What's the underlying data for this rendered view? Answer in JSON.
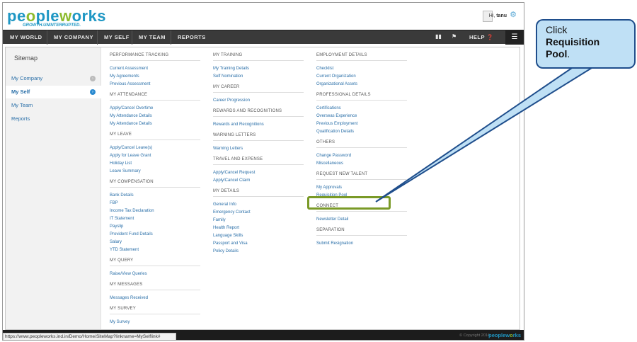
{
  "logo": {
    "main": "peopleworks",
    "tagline": "GROWTH.UNINTERRUPTED."
  },
  "user": {
    "greeting": "Hi, ",
    "name": "tanu"
  },
  "nav": {
    "items": [
      "MY WORLD",
      "MY COMPANY",
      "MY SELF",
      "MY TEAM",
      "REPORTS"
    ],
    "help": "HELP"
  },
  "sidebar": {
    "title": "Sitemap",
    "items": [
      {
        "label": "My Company",
        "active": false
      },
      {
        "label": "My Self",
        "active": true
      },
      {
        "label": "My Team",
        "active": false
      },
      {
        "label": "Reports",
        "active": false
      }
    ]
  },
  "columns": [
    {
      "sections": [
        {
          "title": "PERFORMANCE TRACKING",
          "links": [
            "Current Assessment",
            "My Agreements",
            "Previous Assessment"
          ]
        },
        {
          "title": "MY ATTENDANCE",
          "links": [
            "Apply/Cancel Overtime",
            "My Attendance Details",
            "My Attendance Details"
          ]
        },
        {
          "title": "MY LEAVE",
          "links": [
            "Apply/Cancel Leave(s)",
            "Apply for Leave Grant",
            "Holiday List",
            "Leave Summary"
          ]
        },
        {
          "title": "MY COMPENSATION",
          "links": [
            "Bank Details",
            "FBP",
            "Income Tax Declaration",
            "IT Statement",
            "Payslip",
            "Provident Fund Details",
            "Salary",
            "YTD Statement"
          ]
        },
        {
          "title": "MY QUERY",
          "links": [
            "Raise/View Queries"
          ]
        },
        {
          "title": "MY MESSAGES",
          "links": [
            "Messages Received"
          ]
        },
        {
          "title": "MY SURVEY",
          "links": [
            "My Survey"
          ]
        }
      ]
    },
    {
      "sections": [
        {
          "title": "MY TRAINING",
          "links": [
            "My Training Details",
            "Self Nomination"
          ]
        },
        {
          "title": "MY CAREER",
          "links": [
            "Career Progression"
          ]
        },
        {
          "title": "REWARDS AND RECOGNITIONS",
          "links": [
            "Rewards and Recognitions"
          ]
        },
        {
          "title": "WARNING LETTERS",
          "links": [
            "Warning Letters"
          ]
        },
        {
          "title": "TRAVEL AND EXPENSE",
          "links": [
            "Apply/Cancel Request",
            "Apply/Cancel Claim"
          ]
        },
        {
          "title": "MY DETAILS",
          "links": [
            "General Info",
            "Emergency Contact",
            "Family",
            "Health Report",
            "Language Skills",
            "Passport and Visa",
            "Policy Details"
          ]
        }
      ]
    },
    {
      "sections": [
        {
          "title": "EMPLOYMENT DETAILS",
          "links": [
            "Checklist",
            "Current Organization",
            "Organizational Assets"
          ]
        },
        {
          "title": "PROFESSIONAL DETAILS",
          "links": [
            "Certifications",
            "Overseas Experience",
            "Previous Employment",
            "Qualification Details"
          ]
        },
        {
          "title": "OTHERS",
          "links": [
            "Change Password",
            "Miscellaneous"
          ]
        },
        {
          "title": "REQUEST NEW TALENT",
          "links": [
            "My Approvals",
            "Requisition Pool"
          ]
        },
        {
          "title": "CONNECT",
          "links": [
            "Newsletter Detail"
          ]
        },
        {
          "title": "SEPARATION",
          "links": [
            "Submit Resignation"
          ]
        }
      ]
    }
  ],
  "status_url": "https://www.peopleworks.ind.in/Demo/Home/SiteMap?linkname=MySelflink#",
  "footer": {
    "copyright": "© Copyright 2014",
    "logo": "peopleworks"
  },
  "callout": {
    "line1": "Click",
    "bold": "Requisition Pool",
    "end": "."
  },
  "colors": {
    "accent": "#1f97c4",
    "green": "#8dbb2e",
    "highlight": "#7a9a27",
    "callout_bg": "#bfe0f5"
  }
}
